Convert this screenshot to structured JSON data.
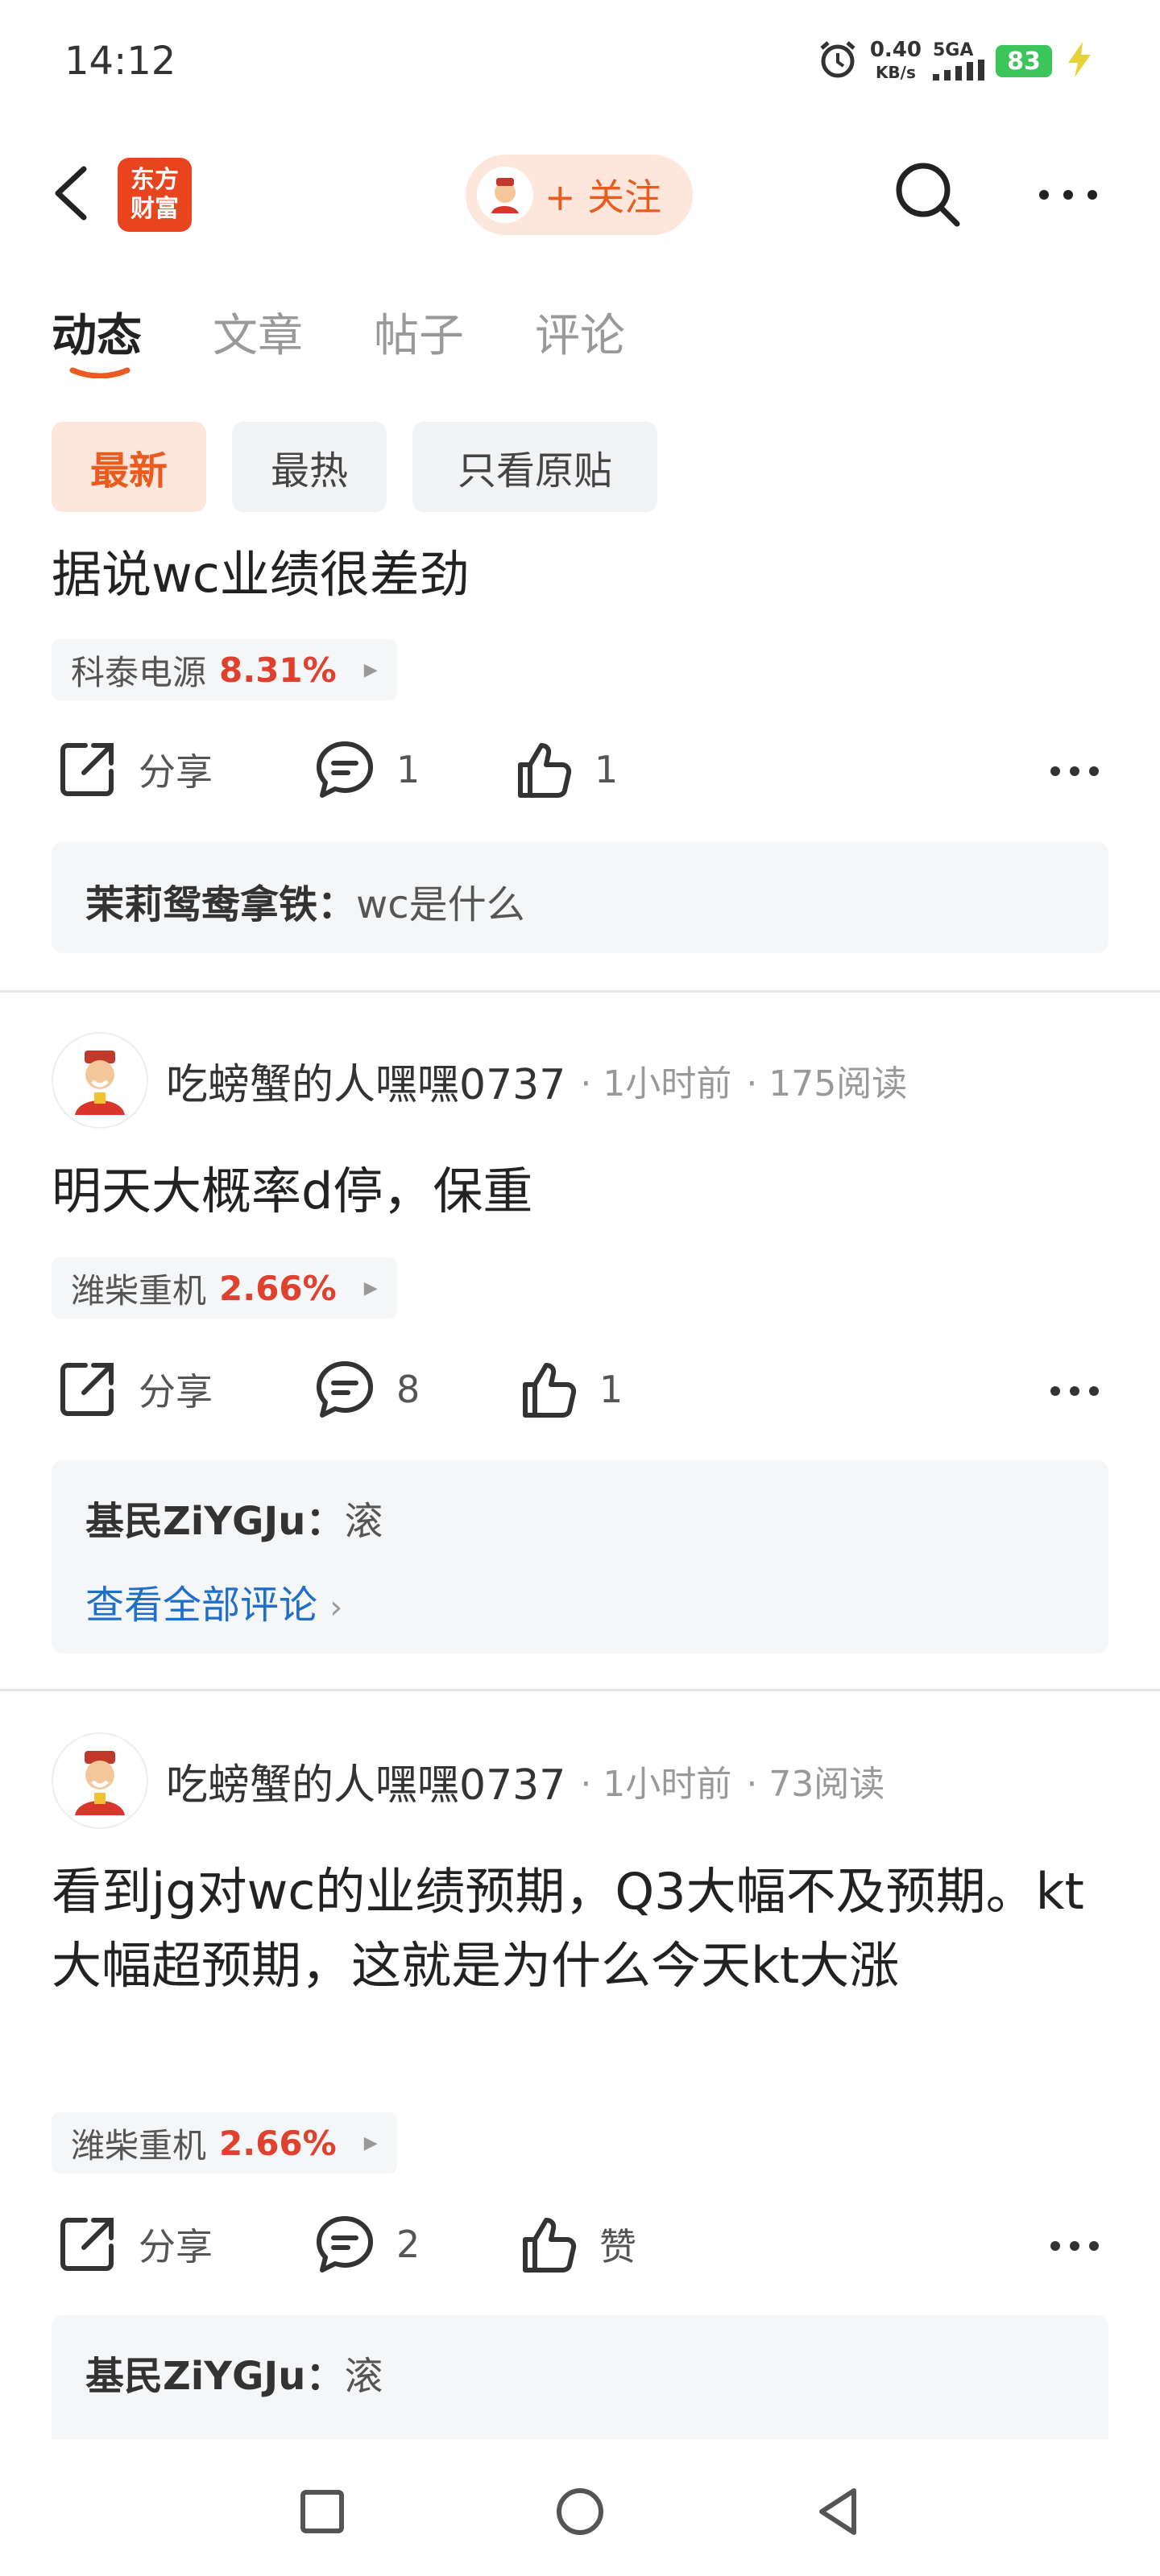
{
  "status_bar": {
    "time": "14:12",
    "net_speed_value": "0.40",
    "net_speed_unit": "KB/s",
    "signal_label": "5GA",
    "battery": "83"
  },
  "header": {
    "logo_line1": "东方",
    "logo_line2": "财富",
    "follow_label": "+ 关注"
  },
  "tabs": [
    {
      "label": "动态",
      "active": true
    },
    {
      "label": "文章",
      "active": false
    },
    {
      "label": "帖子",
      "active": false
    },
    {
      "label": "评论",
      "active": false
    }
  ],
  "filters": [
    {
      "label": "最新",
      "active": true
    },
    {
      "label": "最热",
      "active": false
    },
    {
      "label": "只看原贴",
      "active": false
    }
  ],
  "share_label": "分享",
  "colors": {
    "accent": "#ea5b1f",
    "up": "#e0412e",
    "link": "#1f6fc8"
  },
  "posts": [
    {
      "text": "据说wc业绩很差劲",
      "stock": {
        "name": "科泰电源",
        "change": "8.31%"
      },
      "comments": "1",
      "likes": "1",
      "top_comment": {
        "author": "茉莉鸳鸯拿铁：",
        "text": "wc是什么"
      }
    },
    {
      "author": "吃螃蟹的人嘿嘿0737",
      "time": "· 1小时前",
      "reads": "· 175阅读",
      "text": "明天大概率d停，保重",
      "stock": {
        "name": "潍柴重机",
        "change": "2.66%"
      },
      "comments": "8",
      "likes": "1",
      "top_comment": {
        "author": "基民ZiYGJu：",
        "text": "滚"
      },
      "view_all": "查看全部评论"
    },
    {
      "author": "吃螃蟹的人嘿嘿0737",
      "time": "· 1小时前",
      "reads": "· 73阅读",
      "text": "看到jg对wc的业绩预期，Q3大幅不及预期。kt大幅超预期，这就是为什么今天kt大涨",
      "stock": {
        "name": "潍柴重机",
        "change": "2.66%"
      },
      "comments": "2",
      "likes": "赞",
      "top_comment": {
        "author": "基民ZiYGJu：",
        "text": "滚"
      }
    }
  ]
}
